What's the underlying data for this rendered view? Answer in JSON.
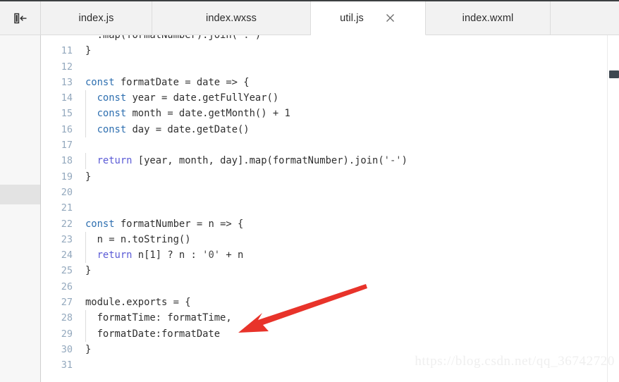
{
  "window": {
    "toggle_panel_icon": "collapse-panel-left-icon"
  },
  "tabbar": {
    "tabs": [
      {
        "label": "index.js",
        "active": false,
        "closable": false
      },
      {
        "label": "index.wxss",
        "active": false,
        "closable": false
      },
      {
        "label": "util.js",
        "active": true,
        "closable": true,
        "close_icon": "close-icon"
      },
      {
        "label": "index.wxml",
        "active": false,
        "closable": false
      }
    ]
  },
  "editor": {
    "file": "util.js",
    "first_visible_partial_line": ".map(formatNumber).join(':')",
    "lines": [
      {
        "number": "",
        "text": "  .map(formatNumber).join(':')"
      },
      {
        "number": "11",
        "text": "}"
      },
      {
        "number": "12",
        "text": ""
      },
      {
        "number": "13",
        "text": "const formatDate = date => {"
      },
      {
        "number": "14",
        "text": "  const year = date.getFullYear()"
      },
      {
        "number": "15",
        "text": "  const month = date.getMonth() + 1"
      },
      {
        "number": "16",
        "text": "  const day = date.getDate()"
      },
      {
        "number": "17",
        "text": ""
      },
      {
        "number": "18",
        "text": "  return [year, month, day].map(formatNumber).join('-')"
      },
      {
        "number": "19",
        "text": "}"
      },
      {
        "number": "20",
        "text": ""
      },
      {
        "number": "21",
        "text": ""
      },
      {
        "number": "22",
        "text": "const formatNumber = n => {"
      },
      {
        "number": "23",
        "text": "  n = n.toString()"
      },
      {
        "number": "24",
        "text": "  return n[1] ? n : '0' + n"
      },
      {
        "number": "25",
        "text": "}"
      },
      {
        "number": "26",
        "text": ""
      },
      {
        "number": "27",
        "text": "module.exports = {"
      },
      {
        "number": "28",
        "text": "  formatTime: formatTime,"
      },
      {
        "number": "29",
        "text": "  formatDate:formatDate"
      },
      {
        "number": "30",
        "text": "}"
      },
      {
        "number": "31",
        "text": ""
      }
    ]
  },
  "annotation": {
    "arrow_color": "#e8332a",
    "arrow_target_line": "29",
    "arrow_target_text": "formatDate:formatDate"
  },
  "scrollbar": {
    "orientation": "vertical",
    "thumb_color": "#3e4750"
  },
  "watermark": {
    "text": "https://blog.csdn.net/qq_36742720"
  },
  "colors": {
    "tabbar_bg": "#f2f2f2",
    "active_tab_bg": "#ffffff",
    "sidebar_bg": "#f7f7f7",
    "editor_bg": "#ffffff",
    "line_number": "#93a8bd",
    "keyword": "#2e6fb0",
    "accent_red": "#e8332a"
  }
}
